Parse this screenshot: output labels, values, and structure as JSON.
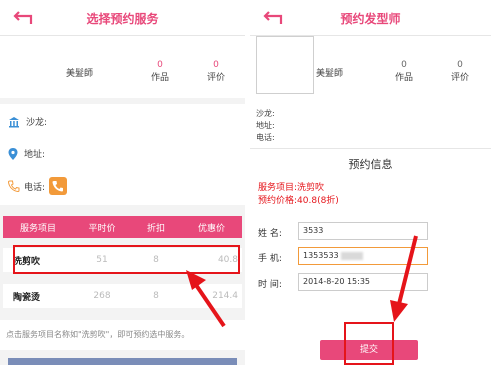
{
  "screen1": {
    "title": "选择预约服务",
    "stylist_name": "美髮師",
    "works_count": "0",
    "works_label": "作品",
    "reviews_count": "0",
    "reviews_label": "评价",
    "salon_label": "沙龙:",
    "address_label": "地址:",
    "phone_label": "电话:",
    "table": {
      "headers": [
        "服务项目",
        "平时价",
        "折扣",
        "优惠价"
      ],
      "rows": [
        [
          "洗剪吹",
          "51",
          "8",
          "40.8"
        ],
        [
          "陶瓷烫",
          "268",
          "8",
          "214.4"
        ]
      ]
    },
    "hint": "点击服务项目名称如\"洗剪吹\"，即可预约选中服务。"
  },
  "screen2": {
    "title": "预约发型师",
    "stylist_name": "美髮師",
    "works_count": "0",
    "works_label": "作品",
    "reviews_count": "0",
    "reviews_label": "评价",
    "salon_label": "沙龙:",
    "address_label": "地址:",
    "phone_label": "电话:",
    "section_title": "预约信息",
    "service_item": "服务项目:洗剪吹",
    "price": "预约价格:40.8(8折)",
    "form": {
      "name_label": "姓  名:",
      "name_value": "3533",
      "phone_label": "手  机:",
      "phone_value": "1353533",
      "time_label": "时  间:",
      "time_value": "2014-8-20 15:35"
    },
    "submit_label": "提交"
  },
  "colors": {
    "accent": "#e8487a",
    "annotation": "#e5141a",
    "phone_icon": "#f29a3a"
  }
}
